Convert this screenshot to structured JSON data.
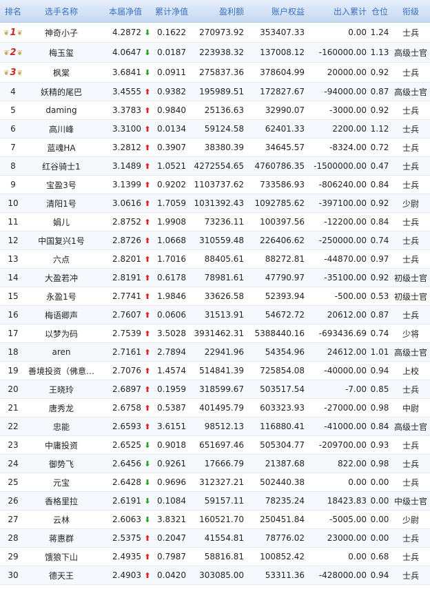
{
  "header": {
    "rank": "排名",
    "name": "选手名称",
    "nav": "本届净值",
    "cum_nav": "累计净值",
    "profit": "盈利额",
    "equity": "账户权益",
    "net_flow": "出入累计",
    "position": "仓位",
    "title": "衔级"
  },
  "icons": {
    "up": "arrow-up-icon",
    "down": "arrow-down-icon",
    "medal": "winged-medal-icon"
  },
  "colors": {
    "up": "#e02020",
    "down": "#24a324",
    "header_text": "#3a6fc4",
    "medal_num": "#c9281f"
  },
  "rows": [
    {
      "rank": "1",
      "name": "神奇小子",
      "nav": "4.2872",
      "dir": "down",
      "cum": "0.1622",
      "profit": "270973.92",
      "equity": "353407.33",
      "flow": "0.00",
      "pos": "1.24",
      "title": "士兵"
    },
    {
      "rank": "2",
      "name": "梅玉玺",
      "nav": "4.0647",
      "dir": "down",
      "cum": "0.0187",
      "profit": "223938.32",
      "equity": "137008.12",
      "flow": "-160000.00",
      "pos": "1.13",
      "title": "高级士官"
    },
    {
      "rank": "3",
      "name": "枫棠",
      "nav": "3.6841",
      "dir": "down",
      "cum": "0.0911",
      "profit": "275837.36",
      "equity": "378604.99",
      "flow": "20000.00",
      "pos": "0.92",
      "title": "士兵"
    },
    {
      "rank": "4",
      "name": "妖精的尾巴",
      "nav": "3.4555",
      "dir": "up",
      "cum": "0.9382",
      "profit": "195989.51",
      "equity": "172827.67",
      "flow": "-94000.00",
      "pos": "0.87",
      "title": "高级士官"
    },
    {
      "rank": "5",
      "name": "daming",
      "nav": "3.3783",
      "dir": "up",
      "cum": "0.9840",
      "profit": "25136.63",
      "equity": "32990.07",
      "flow": "-3000.00",
      "pos": "0.92",
      "title": "士兵"
    },
    {
      "rank": "6",
      "name": "高川峰",
      "nav": "3.3100",
      "dir": "up",
      "cum": "0.0134",
      "profit": "59124.58",
      "equity": "62401.33",
      "flow": "2200.00",
      "pos": "1.12",
      "title": "士兵"
    },
    {
      "rank": "7",
      "name": "蓝魂HA",
      "nav": "3.2812",
      "dir": "up",
      "cum": "0.3907",
      "profit": "38380.39",
      "equity": "34645.57",
      "flow": "-8324.00",
      "pos": "0.72",
      "title": "士兵"
    },
    {
      "rank": "8",
      "name": "红谷骑士1",
      "nav": "3.1489",
      "dir": "up",
      "cum": "1.0521",
      "profit": "4272554.65",
      "equity": "4760786.35",
      "flow": "-1500000.00",
      "pos": "0.47",
      "title": "士兵"
    },
    {
      "rank": "9",
      "name": "宝盈3号",
      "nav": "3.1399",
      "dir": "up",
      "cum": "0.9202",
      "profit": "1103737.62",
      "equity": "733586.93",
      "flow": "-806240.00",
      "pos": "0.84",
      "title": "士兵"
    },
    {
      "rank": "10",
      "name": "清阳1号",
      "nav": "3.0616",
      "dir": "up",
      "cum": "1.7059",
      "profit": "1031392.43",
      "equity": "1092785.62",
      "flow": "-397100.00",
      "pos": "0.92",
      "title": "少尉"
    },
    {
      "rank": "11",
      "name": "娟儿",
      "nav": "2.8752",
      "dir": "up",
      "cum": "1.9908",
      "profit": "73236.11",
      "equity": "100397.56",
      "flow": "-12200.00",
      "pos": "0.84",
      "title": "士兵"
    },
    {
      "rank": "12",
      "name": "中国复兴1号",
      "nav": "2.8726",
      "dir": "up",
      "cum": "1.0668",
      "profit": "310559.48",
      "equity": "226406.62",
      "flow": "-250000.00",
      "pos": "0.74",
      "title": "士兵"
    },
    {
      "rank": "13",
      "name": "六点",
      "nav": "2.8201",
      "dir": "up",
      "cum": "1.7016",
      "profit": "88405.61",
      "equity": "88272.81",
      "flow": "-44870.00",
      "pos": "0.97",
      "title": "士兵"
    },
    {
      "rank": "14",
      "name": "大盈若冲",
      "nav": "2.8191",
      "dir": "up",
      "cum": "0.6178",
      "profit": "78981.61",
      "equity": "47790.97",
      "flow": "-35100.00",
      "pos": "0.92",
      "title": "初级士官"
    },
    {
      "rank": "15",
      "name": "永盈1号",
      "nav": "2.7741",
      "dir": "up",
      "cum": "1.9846",
      "profit": "33626.58",
      "equity": "52393.94",
      "flow": "-500.00",
      "pos": "0.53",
      "title": "初级士官"
    },
    {
      "rank": "16",
      "name": "梅语卿声",
      "nav": "2.7607",
      "dir": "up",
      "cum": "0.0606",
      "profit": "31513.91",
      "equity": "54672.72",
      "flow": "20612.00",
      "pos": "0.87",
      "title": "士兵"
    },
    {
      "rank": "17",
      "name": "以梦为码",
      "nav": "2.7539",
      "dir": "up",
      "cum": "3.5028",
      "profit": "3931462.31",
      "equity": "5388440.16",
      "flow": "-693436.69",
      "pos": "0.74",
      "title": "少将"
    },
    {
      "rank": "18",
      "name": "aren",
      "nav": "2.7161",
      "dir": "up",
      "cum": "2.7894",
      "profit": "22941.96",
      "equity": "54354.96",
      "flow": "24612.00",
      "pos": "1.01",
      "title": "高级士官"
    },
    {
      "rank": "19",
      "name": "善境投资（佛意…",
      "nav": "2.7076",
      "dir": "up",
      "cum": "1.4574",
      "profit": "514841.39",
      "equity": "725854.08",
      "flow": "-40000.00",
      "pos": "0.94",
      "title": "上校"
    },
    {
      "rank": "20",
      "name": "王晓玲",
      "nav": "2.6897",
      "dir": "up",
      "cum": "0.1959",
      "profit": "318599.67",
      "equity": "503517.54",
      "flow": "-7.00",
      "pos": "0.85",
      "title": "士兵"
    },
    {
      "rank": "21",
      "name": "唐秀龙",
      "nav": "2.6758",
      "dir": "up",
      "cum": "0.5387",
      "profit": "401495.79",
      "equity": "603323.93",
      "flow": "-27000.00",
      "pos": "0.98",
      "title": "中尉"
    },
    {
      "rank": "22",
      "name": "忠能",
      "nav": "2.6593",
      "dir": "up",
      "cum": "3.6151",
      "profit": "98512.13",
      "equity": "116880.41",
      "flow": "-41000.00",
      "pos": "0.84",
      "title": "高级士官"
    },
    {
      "rank": "23",
      "name": "中庸投资",
      "nav": "2.6525",
      "dir": "down",
      "cum": "0.9018",
      "profit": "651697.46",
      "equity": "505304.77",
      "flow": "-209700.00",
      "pos": "0.93",
      "title": "士兵"
    },
    {
      "rank": "24",
      "name": "御势飞",
      "nav": "2.6456",
      "dir": "down",
      "cum": "0.9261",
      "profit": "17666.79",
      "equity": "21387.68",
      "flow": "822.00",
      "pos": "0.98",
      "title": "士兵"
    },
    {
      "rank": "25",
      "name": "元宝",
      "nav": "2.6428",
      "dir": "down",
      "cum": "0.9696",
      "profit": "312327.21",
      "equity": "502440.38",
      "flow": "0.00",
      "pos": "0.00",
      "title": "士兵"
    },
    {
      "rank": "26",
      "name": "香格里拉",
      "nav": "2.6191",
      "dir": "down",
      "cum": "0.1084",
      "profit": "59157.11",
      "equity": "78235.24",
      "flow": "18423.83",
      "pos": "0.00",
      "title": "中级士官"
    },
    {
      "rank": "27",
      "name": "云林",
      "nav": "2.6063",
      "dir": "down",
      "cum": "3.8321",
      "profit": "160521.70",
      "equity": "250451.84",
      "flow": "-5005.00",
      "pos": "0.00",
      "title": "少尉"
    },
    {
      "rank": "28",
      "name": "蒋惠群",
      "nav": "2.5375",
      "dir": "up",
      "cum": "0.2047",
      "profit": "41554.81",
      "equity": "78776.02",
      "flow": "23000.00",
      "pos": "0.00",
      "title": "士兵"
    },
    {
      "rank": "29",
      "name": "饿狼下山",
      "nav": "2.4935",
      "dir": "up",
      "cum": "0.7987",
      "profit": "58816.81",
      "equity": "100852.42",
      "flow": "0.00",
      "pos": "0.68",
      "title": "士兵"
    },
    {
      "rank": "30",
      "name": "德天王",
      "nav": "2.4903",
      "dir": "up",
      "cum": "0.0420",
      "profit": "303085.00",
      "equity": "53311.36",
      "flow": "-428000.00",
      "pos": "0.94",
      "title": "士兵"
    }
  ]
}
